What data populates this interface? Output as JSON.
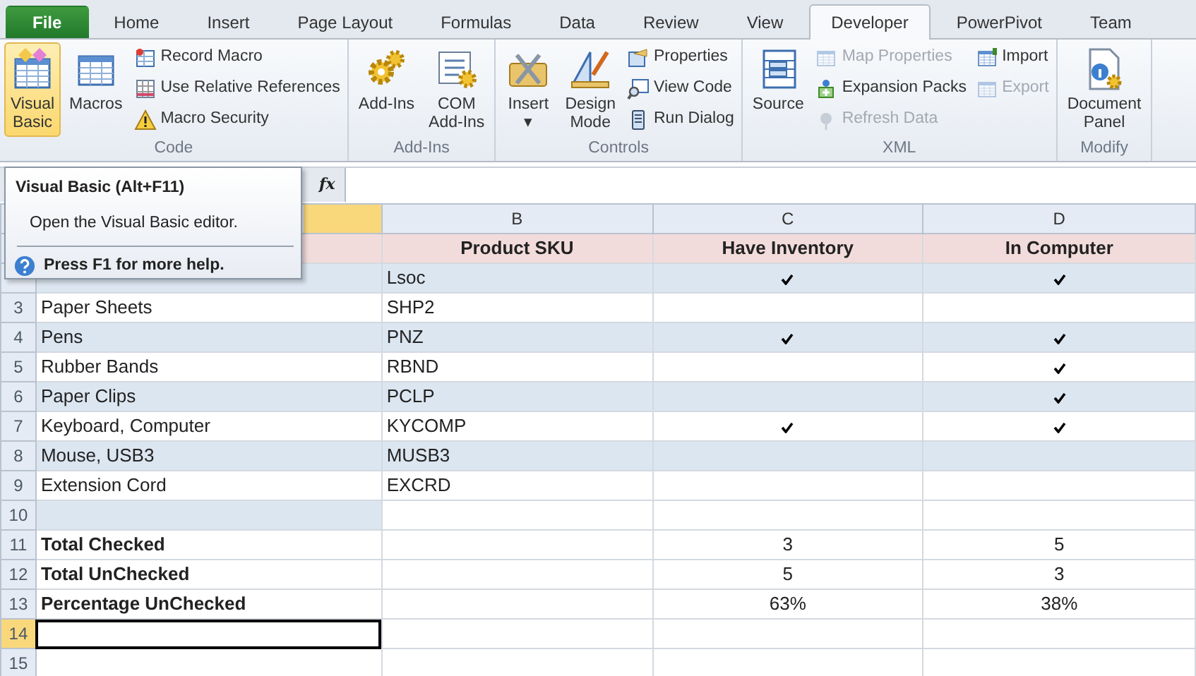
{
  "tabs": [
    {
      "label": "File",
      "kind": "file",
      "selected": false
    },
    {
      "label": "Home",
      "kind": "tab",
      "selected": false
    },
    {
      "label": "Insert",
      "kind": "tab",
      "selected": false
    },
    {
      "label": "Page Layout",
      "kind": "tab",
      "selected": false
    },
    {
      "label": "Formulas",
      "kind": "tab",
      "selected": false
    },
    {
      "label": "Data",
      "kind": "tab",
      "selected": false
    },
    {
      "label": "Review",
      "kind": "tab",
      "selected": false
    },
    {
      "label": "View",
      "kind": "tab",
      "selected": false
    },
    {
      "label": "Developer",
      "kind": "tab",
      "selected": true
    },
    {
      "label": "PowerPivot",
      "kind": "tab",
      "selected": false
    },
    {
      "label": "Team",
      "kind": "tab",
      "selected": false
    }
  ],
  "ribbon": {
    "groups": [
      {
        "label": "Code",
        "items": [
          {
            "kind": "large",
            "lines": [
              "Visual",
              "Basic"
            ],
            "selected": true
          },
          {
            "kind": "large",
            "lines": [
              "Macros"
            ],
            "selected": false
          },
          {
            "kind": "stack",
            "items": [
              {
                "label": "Record Macro",
                "disabled": false
              },
              {
                "label": "Use Relative References",
                "disabled": false
              },
              {
                "label": "Macro Security",
                "disabled": false
              }
            ]
          }
        ]
      },
      {
        "label": "Add-Ins",
        "items": [
          {
            "kind": "large",
            "lines": [
              "Add-Ins"
            ],
            "selected": false
          },
          {
            "kind": "large",
            "lines": [
              "COM",
              "Add-Ins"
            ],
            "selected": false
          }
        ]
      },
      {
        "label": "Controls",
        "items": [
          {
            "kind": "large",
            "lines": [
              "Insert"
            ],
            "dropdown": "▾",
            "selected": false
          },
          {
            "kind": "large",
            "lines": [
              "Design",
              "Mode"
            ],
            "selected": false
          },
          {
            "kind": "stack",
            "items": [
              {
                "label": "Properties",
                "disabled": false
              },
              {
                "label": "View Code",
                "disabled": false
              },
              {
                "label": "Run Dialog",
                "disabled": false
              }
            ]
          }
        ]
      },
      {
        "label": "XML",
        "items": [
          {
            "kind": "large",
            "lines": [
              "Source"
            ],
            "selected": false
          },
          {
            "kind": "stack",
            "items": [
              {
                "label": "Map Properties",
                "disabled": true
              },
              {
                "label": "Expansion Packs",
                "disabled": false
              },
              {
                "label": "Refresh Data",
                "disabled": true
              }
            ]
          },
          {
            "kind": "stack",
            "items": [
              {
                "label": "Import",
                "disabled": false
              },
              {
                "label": "Export",
                "disabled": true
              }
            ]
          }
        ]
      },
      {
        "label": "Modify",
        "items": [
          {
            "kind": "large",
            "lines": [
              "Document",
              "Panel"
            ],
            "selected": false
          }
        ]
      }
    ]
  },
  "tooltip": {
    "title": "Visual Basic (Alt+F11)",
    "description": "Open the Visual Basic editor.",
    "help": "Press F1 for more help."
  },
  "formula_bar": {
    "fx": "fx"
  },
  "columns": [
    {
      "selected": true
    },
    {
      "label": "B",
      "selected": false
    },
    {
      "label": "C",
      "selected": false
    },
    {
      "label": "D",
      "selected": false
    }
  ],
  "rows": [
    {
      "kind": "header",
      "sku": "Product SKU",
      "have_inventory": "Have Inventory",
      "in_computer": "In Computer"
    },
    {
      "kind": "item",
      "shaded": true,
      "sku": "Lsoc",
      "have_inventory": true,
      "in_computer": true
    },
    {
      "kind": "item",
      "number": "3",
      "shaded": false,
      "name": "Paper Sheets",
      "sku": "SHP2",
      "have_inventory": false,
      "in_computer": false
    },
    {
      "kind": "item",
      "number": "4",
      "shaded": true,
      "name": "Pens",
      "sku": "PNZ",
      "have_inventory": true,
      "in_computer": true
    },
    {
      "kind": "item",
      "number": "5",
      "shaded": false,
      "name": "Rubber Bands",
      "sku": "RBND",
      "have_inventory": false,
      "in_computer": true
    },
    {
      "kind": "item",
      "number": "6",
      "shaded": true,
      "name": "Paper Clips",
      "sku": "PCLP",
      "have_inventory": false,
      "in_computer": true
    },
    {
      "kind": "item",
      "number": "7",
      "shaded": false,
      "name": "Keyboard, Computer",
      "sku": "KYCOMP",
      "have_inventory": true,
      "in_computer": true
    },
    {
      "kind": "item",
      "number": "8",
      "shaded": true,
      "name": "Mouse, USB3",
      "sku": "MUSB3",
      "have_inventory": false,
      "in_computer": false
    },
    {
      "kind": "item",
      "number": "9",
      "shaded": false,
      "name": "Extension Cord",
      "sku": "EXCRD",
      "have_inventory": false,
      "in_computer": false
    },
    {
      "kind": "blank",
      "number": "10",
      "shaded": true,
      "selected": false
    },
    {
      "kind": "total",
      "number": "11",
      "label": "Total Checked",
      "have_inventory": "3",
      "in_computer": "5"
    },
    {
      "kind": "total",
      "number": "12",
      "label": "Total UnChecked",
      "have_inventory": "5",
      "in_computer": "3"
    },
    {
      "kind": "total",
      "number": "13",
      "label": "Percentage UnChecked",
      "have_inventory": "63%",
      "in_computer": "38%"
    },
    {
      "kind": "blank",
      "number": "14",
      "shaded": false,
      "selected": true
    },
    {
      "kind": "blank",
      "number": "15",
      "shaded": false,
      "selected": false
    }
  ]
}
